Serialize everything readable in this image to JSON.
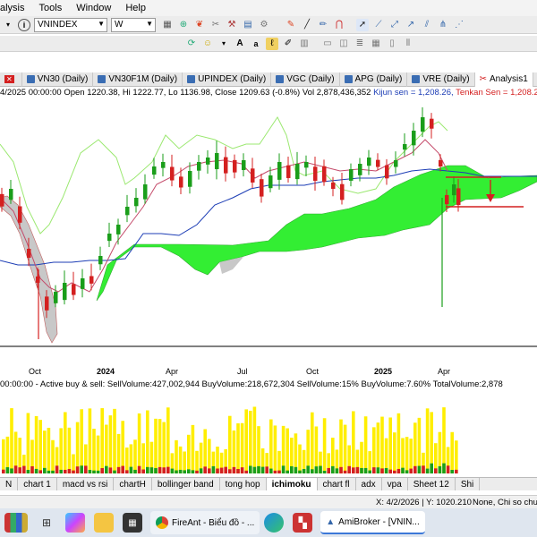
{
  "menu": [
    "alysis",
    "Tools",
    "Window",
    "Help"
  ],
  "toolbar": {
    "symbol": "VNINDEX",
    "interval": "W"
  },
  "tabs": [
    {
      "label": "VN30 (Daily)"
    },
    {
      "label": "VN30F1M (Daily)"
    },
    {
      "label": "UPINDEX (Daily)"
    },
    {
      "label": "VGC (Daily)"
    },
    {
      "label": "APG (Daily)"
    },
    {
      "label": "VRE (Daily)"
    },
    {
      "label": "Analysis1"
    }
  ],
  "info": {
    "main": "4/2025 00:00:00 Open 1220.38, Hi 1222.77, Lo 1136.98, Close 1209.63 (-0.8%) Vol 2,878,436,352",
    "kijun": "Kijun sen = 1,208.26,",
    "tenkan": "Tenkan Sen = 1,208.2"
  },
  "x_axis": [
    "Oct",
    "2024",
    "Apr",
    "Jul",
    "Oct",
    "2025",
    "Apr"
  ],
  "volume_info": "00:00:00 - Active buy & sell:   SellVolume:427,002,944   BuyVolume:218,672,304   SellVolume:15%   BuyVolume:7.60%   TotalVolume:2,878",
  "sheets": [
    "N",
    "chart 1",
    "macd vs rsi",
    "chartH",
    "bollinger band",
    "tong hop",
    "ichimoku",
    "chart fl",
    "adx",
    "vpa",
    "Sheet 12",
    "Shi"
  ],
  "active_sheet": "ichimoku",
  "status": {
    "coords": "X: 4/2/2026 | Y: 1020.210",
    "note": "None, Chi so chun"
  },
  "taskbar": {
    "fireant": "FireAnt - Biểu đồ - ...",
    "amibroker": "AmiBroker - [VNIN..."
  },
  "colors": {
    "candle_up": "#1a9e1a",
    "candle_down": "#d42020",
    "kumo_bull": "#33ee33",
    "kumo_bear": "#c8c8c8",
    "kijun": "#1c3db5",
    "tenkan": "#d42020",
    "chikou": "#9be870"
  }
}
